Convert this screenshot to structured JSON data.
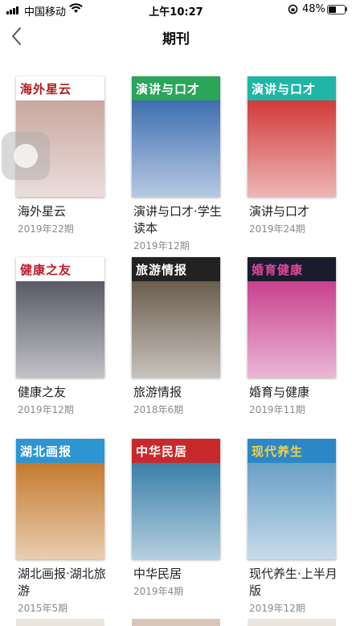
{
  "status_bar": {
    "carrier": "中国移动",
    "time": "上午10:27",
    "battery": "48%",
    "battery_level": 0.48
  },
  "nav": {
    "title": "期刊"
  },
  "magazines": [
    {
      "name": "海外星云",
      "period": "2019年22期",
      "cover_title": "海外星云",
      "colors": {
        "header": "#ffffff",
        "header_text": "#b01a1a",
        "art": "#c9a7a0"
      }
    },
    {
      "name": "演讲与口才·学生读本",
      "period": "2019年12期",
      "cover_title": "演讲与口才",
      "colors": {
        "header": "#2aa55a",
        "header_text": "#ffffff",
        "art": "#3f6fb0"
      }
    },
    {
      "name": "演讲与口才",
      "period": "2019年24期",
      "cover_title": "演讲与口才",
      "colors": {
        "header": "#1fb6a6",
        "header_text": "#ffffff",
        "art": "#d23a3a"
      }
    },
    {
      "name": "健康之友",
      "period": "2019年12期",
      "cover_title": "健康之友",
      "colors": {
        "header": "#ffffff",
        "header_text": "#c01b2c",
        "art": "#5a5a66"
      }
    },
    {
      "name": "旅游情报",
      "period": "2018年6期",
      "cover_title": "旅游情报",
      "colors": {
        "header": "#222222",
        "header_text": "#ffffff",
        "art": "#6b5d4e"
      }
    },
    {
      "name": "婚育与健康",
      "period": "2019年11期",
      "cover_title": "婚育健康",
      "colors": {
        "header": "#1b1b2e",
        "header_text": "#e0489a",
        "art": "#c8408e"
      }
    },
    {
      "name": "湖北画报·湖北旅游",
      "period": "2015年5期",
      "cover_title": "湖北画报",
      "colors": {
        "header": "#2d95d1",
        "header_text": "#ffffff",
        "art": "#c47a2e"
      }
    },
    {
      "name": "中华民居",
      "period": "2019年4期",
      "cover_title": "中华民居",
      "colors": {
        "header": "#c8292b",
        "header_text": "#ffffff",
        "art": "#3a7fa8"
      }
    },
    {
      "name": "现代养生·上半月版",
      "period": "2019年12期",
      "cover_title": "现代养生",
      "colors": {
        "header": "#2b87c8",
        "header_text": "#f3d24a",
        "art": "#6aa0c6"
      }
    }
  ]
}
